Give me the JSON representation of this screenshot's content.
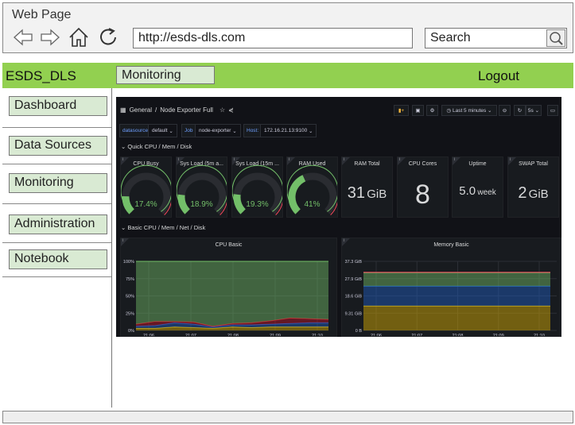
{
  "browser": {
    "title": "Web Page",
    "url": "http://esds-dls.com",
    "search_placeholder": "Search"
  },
  "topbar": {
    "brand": "ESDS_DLS",
    "active_tab": "Monitoring",
    "logout": "Logout",
    "color": "#92d050"
  },
  "sidebar": {
    "items": [
      {
        "label": "Dashboard"
      },
      {
        "label": "Data Sources"
      },
      {
        "label": "Monitoring"
      },
      {
        "label": "Administration"
      },
      {
        "label": "Notebook"
      }
    ]
  },
  "grafana": {
    "breadcrumb": {
      "folder": "General",
      "separator": "/",
      "dashboard": "Node Exporter Full"
    },
    "time_range": "Last 5 minutes",
    "refresh": "5s",
    "variables": [
      {
        "label": "datasource",
        "value": "default"
      },
      {
        "label": "Job",
        "value": "node-exporter"
      },
      {
        "label": "Host:",
        "value": "172.16.21.13:9100"
      }
    ],
    "rows": [
      "Quick CPU / Mem / Disk",
      "Basic CPU / Mem / Net / Disk"
    ],
    "gauges": [
      {
        "title": "CPU Busy",
        "value": "17.4%",
        "level": 17.4
      },
      {
        "title": "Sys Load (5m a...",
        "value": "18.9%",
        "level": 18.9
      },
      {
        "title": "Sys Load (15m ...",
        "value": "19.3%",
        "level": 19.3
      },
      {
        "title": "RAM Used",
        "value": "41%",
        "level": 41
      }
    ],
    "stats": [
      {
        "title": "RAM Total",
        "value": "31",
        "unit": "GiB"
      },
      {
        "title": "CPU Cores",
        "value": "8",
        "unit": ""
      },
      {
        "title": "Uptime",
        "value": "5.0",
        "unit": "week"
      },
      {
        "title": "SWAP Total",
        "value": "2",
        "unit": "GiB"
      }
    ],
    "charts": [
      {
        "title": "CPU Basic",
        "type": "area",
        "x": [
          "21:06",
          "21:07",
          "21:08",
          "21:09",
          "21:10"
        ],
        "yticks": [
          "0%",
          "25%",
          "50%",
          "75%",
          "100%"
        ],
        "ylim": [
          0,
          100
        ],
        "series": [
          {
            "color": "#e0b400",
            "values": [
              3,
              3,
              5,
              4,
              3,
              5,
              4,
              5,
              5,
              5,
              5
            ]
          },
          {
            "color": "#1f60c4",
            "values": [
              3,
              4,
              6,
              5,
              2,
              3,
              4,
              4,
              5,
              6,
              6
            ]
          },
          {
            "color": "#c4162a",
            "values": [
              3,
              6,
              2,
              3,
              1,
              2,
              3,
              5,
              8,
              6,
              5
            ]
          },
          {
            "color": "#73bf69",
            "values": [
              91,
              87,
              87,
              88,
              94,
              90,
              89,
              86,
              82,
              83,
              84
            ]
          }
        ]
      },
      {
        "title": "Memory Basic",
        "type": "area",
        "x": [
          "21:06",
          "21:07",
          "21:08",
          "21:09",
          "21:10"
        ],
        "yticks": [
          "0 B",
          "9.31 GiB",
          "18.6 GiB",
          "27.9 GiB",
          "37.3 GiB"
        ],
        "ylim": [
          0,
          37.3
        ],
        "series": [
          {
            "color": "#e0b400",
            "values": [
              13.2,
              13.2
            ]
          },
          {
            "color": "#1f60c4",
            "values": [
              10.7,
              10.7
            ]
          },
          {
            "color": "#73bf69",
            "values": [
              7.3,
              7.3
            ]
          },
          {
            "color": "#f2495c",
            "values": [
              0.2,
              0.2
            ]
          }
        ]
      }
    ]
  }
}
